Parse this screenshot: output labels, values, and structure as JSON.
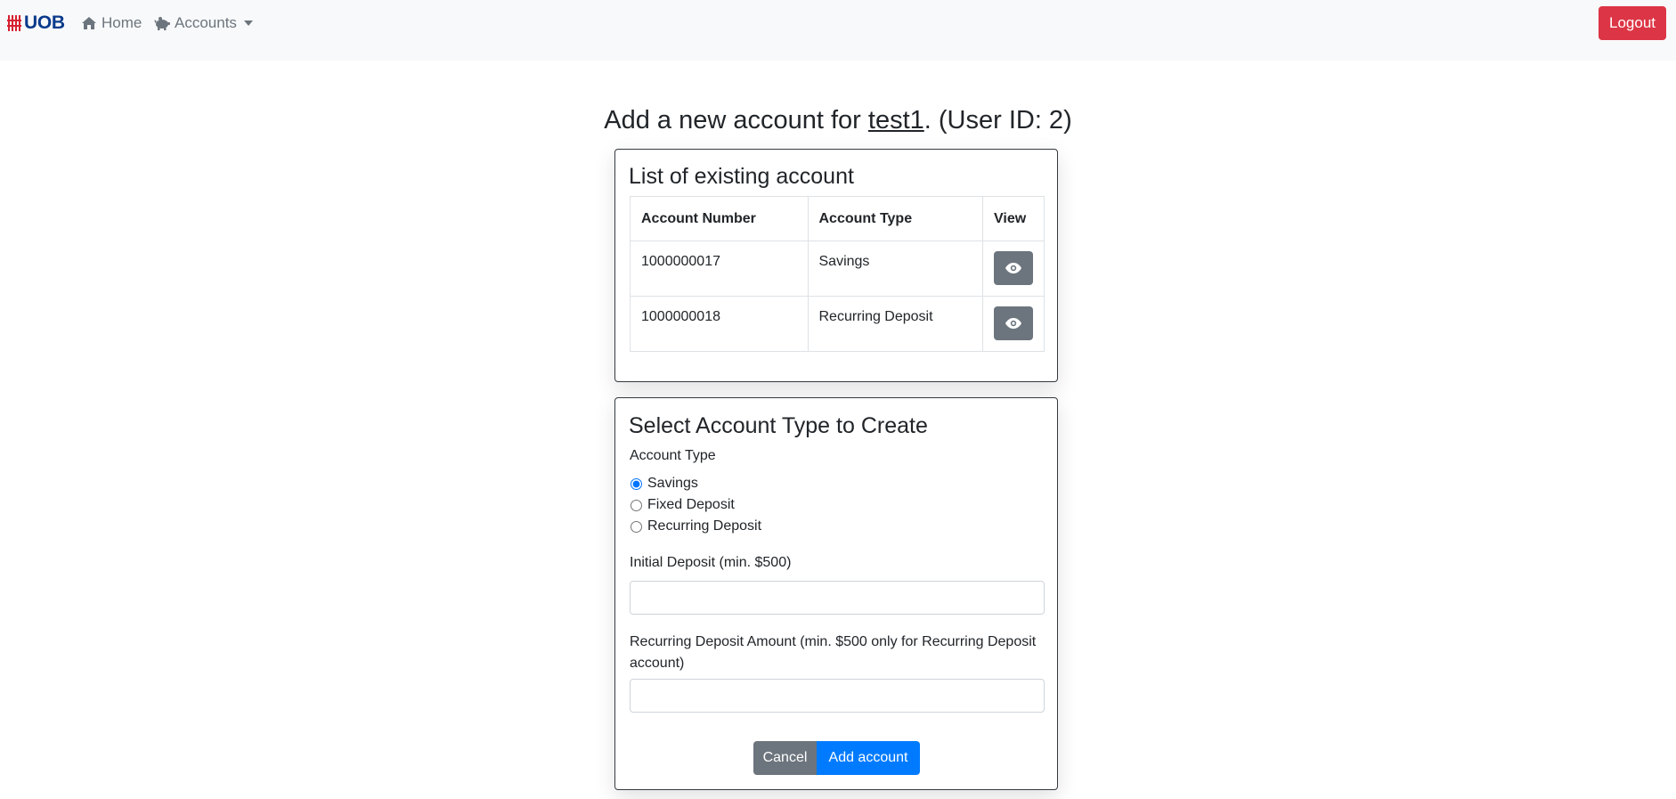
{
  "nav": {
    "brand": "UOB",
    "home": "Home",
    "accounts": "Accounts",
    "logout": "Logout"
  },
  "heading": {
    "prefix": "Add a new account for ",
    "username": "test1",
    "suffix": ". (User ID: 2)"
  },
  "existing": {
    "title": "List of existing account",
    "columns": [
      "Account Number",
      "Account Type",
      "View"
    ],
    "rows": [
      {
        "number": "1000000017",
        "type": "Savings"
      },
      {
        "number": "1000000018",
        "type": "Recurring Deposit"
      }
    ]
  },
  "create": {
    "title": "Select Account Type to Create",
    "type_label": "Account Type",
    "options": [
      {
        "label": "Savings",
        "checked": true
      },
      {
        "label": "Fixed Deposit",
        "checked": false
      },
      {
        "label": "Recurring Deposit",
        "checked": false
      }
    ],
    "initial_label": "Initial Deposit (min. $500)",
    "initial_value": "",
    "recurring_label": "Recurring Deposit Amount (min. $500 only for Recurring Deposit account)",
    "recurring_value": "",
    "cancel": "Cancel",
    "add": "Add account"
  },
  "colors": {
    "brand": "#0a3a8c",
    "brand_stripes": "#d6202f",
    "logout": "#dc3545",
    "primary": "#007bff",
    "secondary": "#6c757d"
  },
  "icons": [
    "home-icon",
    "piggy-bank-icon",
    "eye-icon"
  ]
}
